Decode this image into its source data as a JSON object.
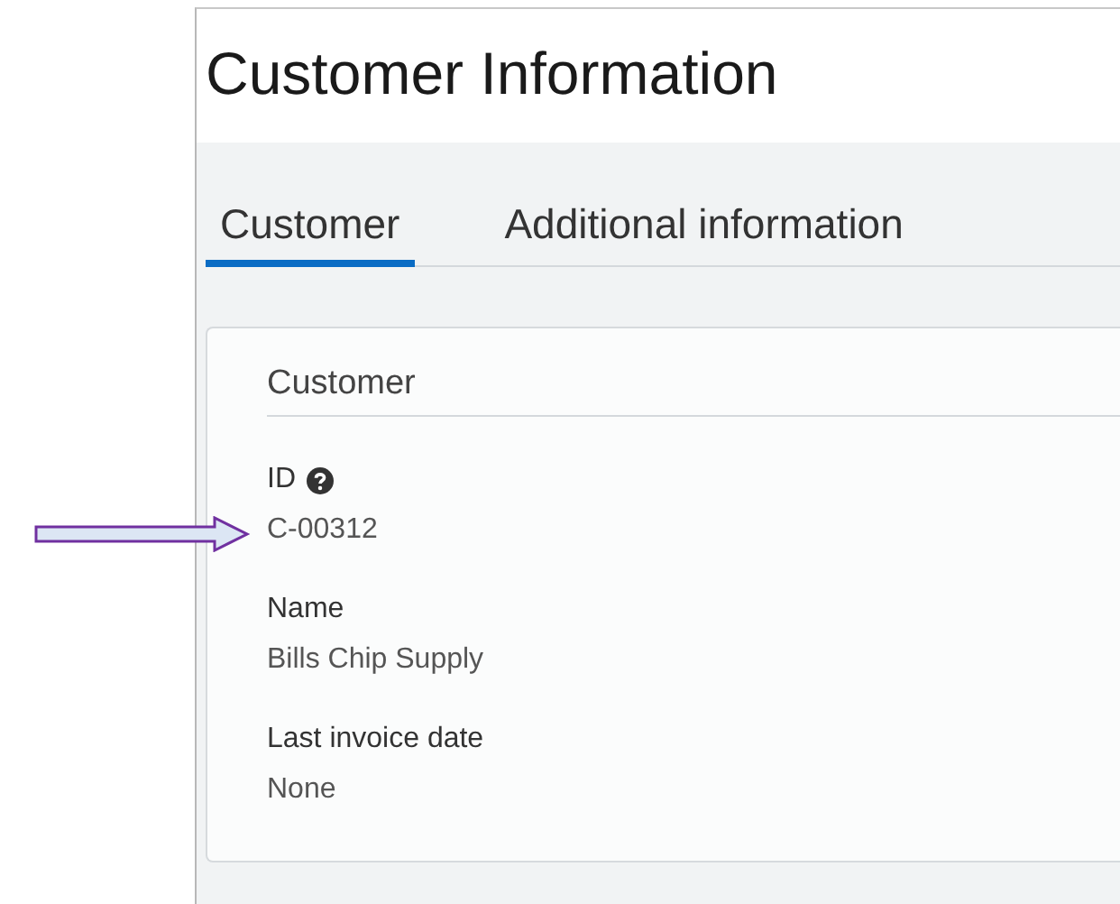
{
  "page": {
    "title": "Customer Information"
  },
  "tabs": [
    {
      "label": "Customer",
      "selected": true
    },
    {
      "label": "Additional information",
      "selected": false
    }
  ],
  "section": {
    "title": "Customer",
    "fields": [
      {
        "label": "ID",
        "help": true,
        "value": "C-00312",
        "pointed": true
      },
      {
        "label": "Name",
        "help": false,
        "value": "Bills Chip Supply",
        "pointed": false
      },
      {
        "label": "Last invoice date",
        "help": false,
        "value": "None",
        "pointed": false
      }
    ]
  }
}
